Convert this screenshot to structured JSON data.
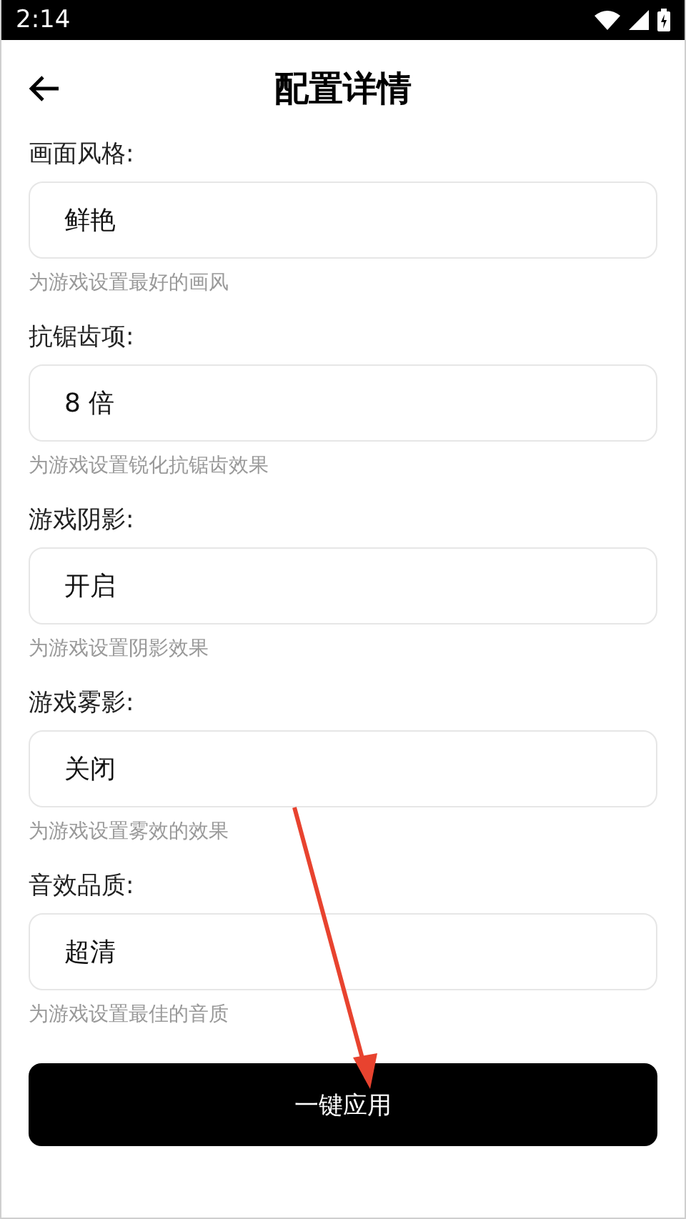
{
  "status_bar": {
    "time": "2:14"
  },
  "header": {
    "title": "配置详情"
  },
  "settings": [
    {
      "label": "画面风格:",
      "value": "鲜艳",
      "hint": "为游戏设置最好的画风"
    },
    {
      "label": "抗锯齿项:",
      "value": "8 倍",
      "hint": "为游戏设置锐化抗锯齿效果"
    },
    {
      "label": "游戏阴影:",
      "value": "开启",
      "hint": "为游戏设置阴影效果"
    },
    {
      "label": "游戏雾影:",
      "value": "关闭",
      "hint": "为游戏设置雾效的效果"
    },
    {
      "label": "音效品质:",
      "value": "超清",
      "hint": "为游戏设置最佳的音质"
    }
  ],
  "apply_button": {
    "label": "一键应用"
  }
}
